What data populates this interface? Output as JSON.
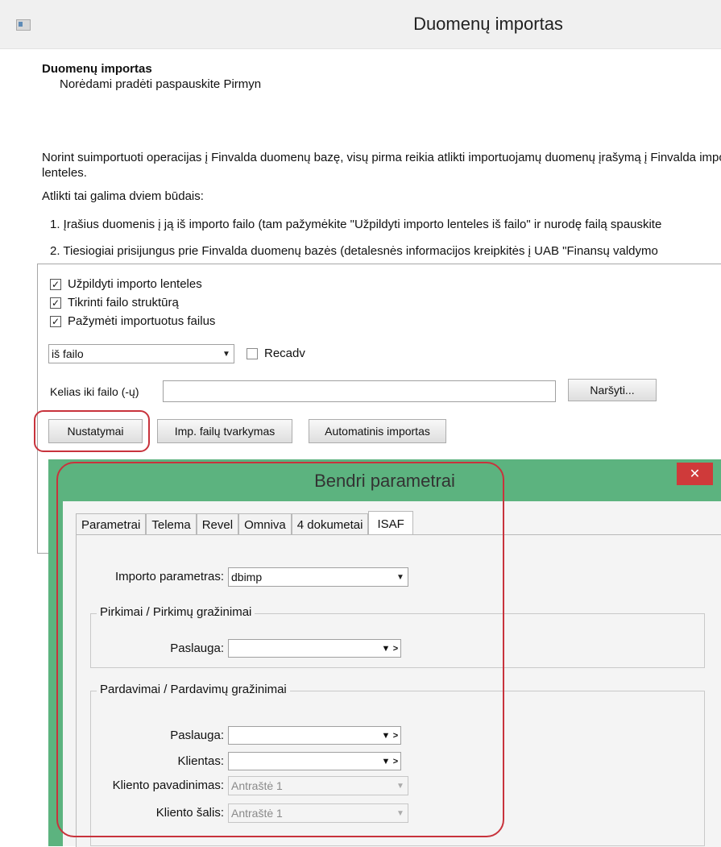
{
  "window": {
    "title": "Duomenų importas"
  },
  "header": {
    "title": "Duomenų importas",
    "subtitle": "Norėdami pradėti paspauskite Pirmyn"
  },
  "intro": {
    "line1": "Norint suimportuoti operacijas į Finvalda duomenų bazę, visų pirma reikia atlikti importuojamų duomenų įrašymą į Finvalda importo",
    "line2": "lenteles.",
    "ways": "Atlikti tai galima dviem būdais:",
    "step1": "1. Įrašius duomenis į ją iš importo failo (tam pažymėkite \"Užpildyti importo lenteles iš failo\" ir nurodę failą spauskite",
    "step2": "2. Tiesiogiai prisijungus prie Finvalda duomenų bazės (detalesnės informacijos kreipkitės į UAB \"Finansų valdymo"
  },
  "options": {
    "fill_tables": "Užpildyti importo lenteles",
    "check_structure": "Tikrinti failo struktūrą",
    "mark_imported": "Pažymėti importuotus failus",
    "source_select": "iš failo",
    "recadv": "Recadv",
    "path_label": "Kelias iki failo (-ų)",
    "path_value": "",
    "browse": "Naršyti..."
  },
  "buttons": {
    "settings": "Nustatymai",
    "file_mgmt": "Imp. failų tvarkymas",
    "auto_import": "Automatinis importas"
  },
  "dialog": {
    "title": "Bendri parametrai",
    "close": "✕",
    "tabs": [
      "Parametrai",
      "Telema",
      "Revel",
      "Omniva",
      "4 dokumetai",
      "ISAF"
    ],
    "active_tab": "ISAF",
    "import_param_label": "Importo parametras:",
    "import_param_value": "dbimp",
    "purchases_group": "Pirkimai / Pirkimų gražinimai",
    "sales_group": "Pardavimai / Pardavimų gražinimai",
    "service_label": "Paslauga:",
    "client_label": "Klientas:",
    "client_name_label": "Kliento pavadinimas:",
    "client_name_value": "Antraštė 1",
    "client_country_label": "Kliento šalis:",
    "client_country_value": "Antraštė 1"
  },
  "colors": {
    "dialog_frame": "#5cb37f",
    "annotation": "#c8333c",
    "close_button": "#cf3a3a"
  }
}
